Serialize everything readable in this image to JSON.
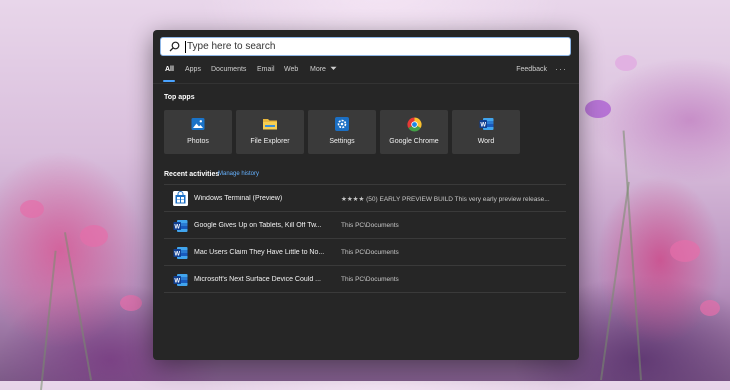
{
  "search": {
    "placeholder": "Type here to search"
  },
  "tabs": [
    {
      "label": "All",
      "active": true
    },
    {
      "label": "Apps"
    },
    {
      "label": "Documents"
    },
    {
      "label": "Email"
    },
    {
      "label": "Web"
    },
    {
      "label": "More"
    }
  ],
  "feedback_label": "Feedback",
  "more_options": "···",
  "top_apps": {
    "title": "Top apps",
    "items": [
      {
        "label": "Photos",
        "icon": "photos-icon"
      },
      {
        "label": "File Explorer",
        "icon": "folder-icon"
      },
      {
        "label": "Settings",
        "icon": "gear-icon"
      },
      {
        "label": "Google Chrome",
        "icon": "chrome-icon"
      },
      {
        "label": "Word",
        "icon": "word-icon"
      }
    ]
  },
  "recent": {
    "title": "Recent activities",
    "manage_link": "Manage history",
    "items": [
      {
        "title": "Windows Terminal (Preview)",
        "path": "★★★★ (50) EARLY PREVIEW BUILD This very early preview release...",
        "icon": "store-icon"
      },
      {
        "title": "Google Gives Up on Tablets, Kill Off Tw...",
        "path": "This PC\\Documents",
        "icon": "word-icon"
      },
      {
        "title": "Mac Users Claim They Have Little to No...",
        "path": "This PC\\Documents",
        "icon": "word-icon"
      },
      {
        "title": "Microsoft's Next Surface Device Could ...",
        "path": "This PC\\Documents",
        "icon": "word-icon"
      }
    ]
  },
  "colors": {
    "accent": "#4aa3ff",
    "panel": "#262626",
    "tile": "#3a3a3a"
  }
}
